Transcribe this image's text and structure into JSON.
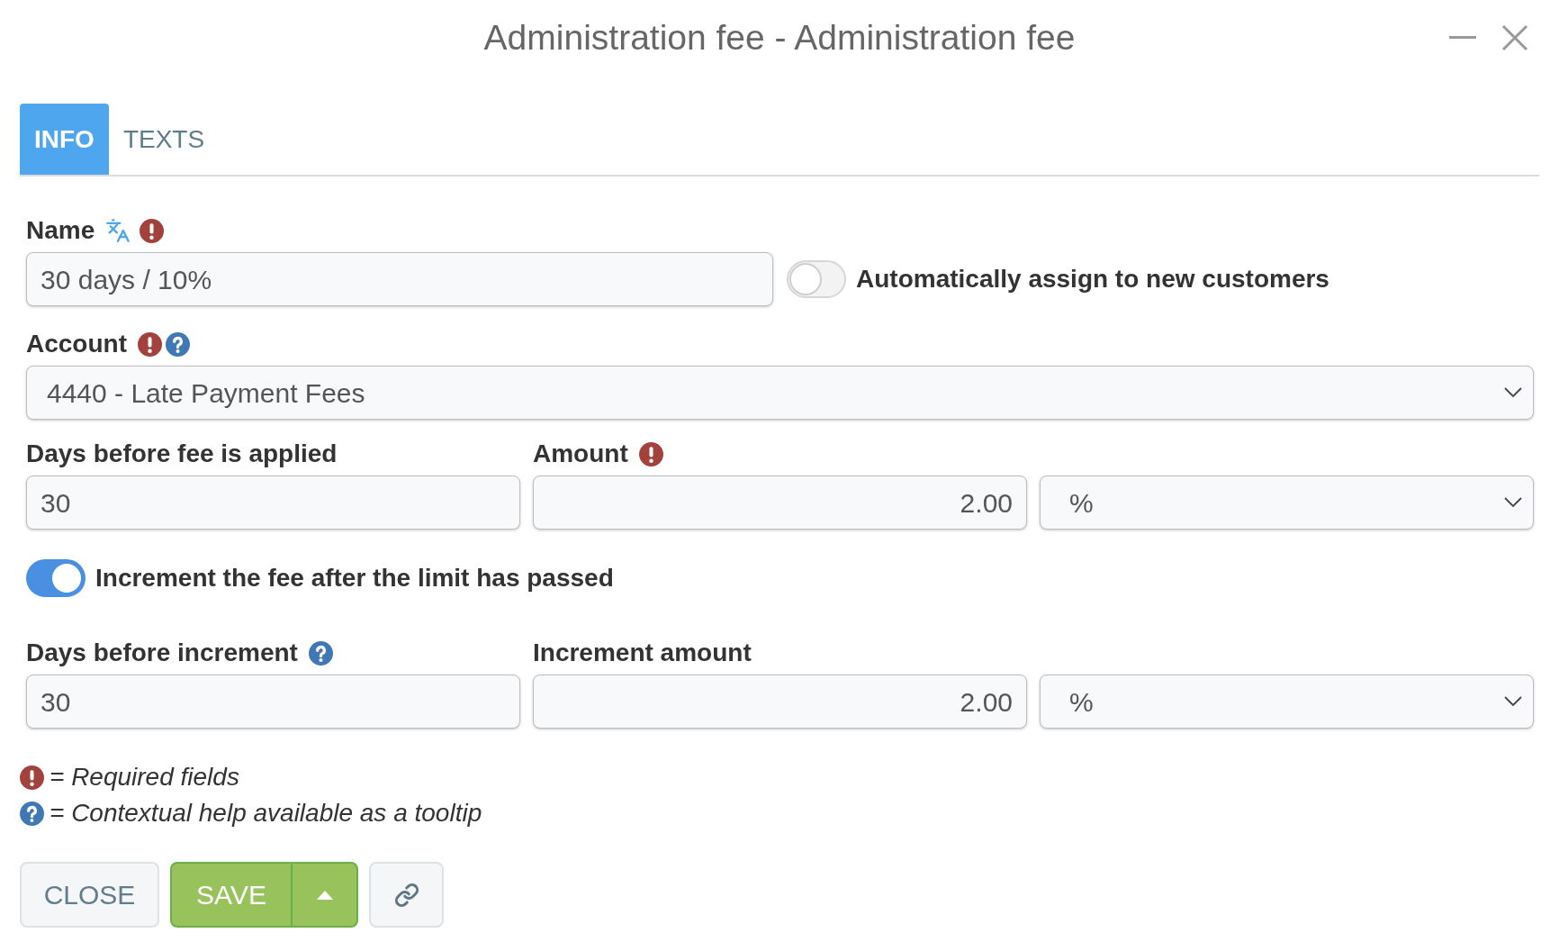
{
  "window": {
    "title": "Administration fee - Administration fee"
  },
  "tabs": [
    {
      "label": "INFO",
      "selected": true
    },
    {
      "label": "TEXTS",
      "selected": false
    }
  ],
  "name_field": {
    "label": "Name",
    "translatable": true,
    "required": true,
    "help": false,
    "value": "30 days / 10%"
  },
  "auto_assign_toggle": {
    "label": "Automatically assign to new customers",
    "on": false
  },
  "account_field": {
    "label": "Account",
    "required": true,
    "help": true,
    "value": "4440 - Late Payment Fees"
  },
  "fee_row": [
    {
      "kind": "text",
      "label": "Days before fee is applied",
      "required": false,
      "help": false,
      "value": "30"
    },
    {
      "kind": "number",
      "label": "Amount",
      "required": true,
      "help": false,
      "value": "2.00"
    },
    {
      "kind": "select",
      "value": "%"
    }
  ],
  "increment_toggle": {
    "label": "Increment the fee after the limit has passed",
    "on": true
  },
  "increment_row": [
    {
      "kind": "text",
      "label": "Days before increment",
      "required": false,
      "help": true,
      "value": "30"
    },
    {
      "kind": "number",
      "label": "Increment amount",
      "required": false,
      "help": false,
      "value": "2.00"
    },
    {
      "kind": "select",
      "value": "%"
    }
  ],
  "legend": [
    {
      "kind": "required",
      "text": "= Required fields"
    },
    {
      "kind": "help",
      "text": "= Contextual help available as a tooltip"
    }
  ],
  "buttons": [
    {
      "kind": "secondary",
      "label": "CLOSE"
    },
    {
      "kind": "split",
      "label": "SAVE"
    },
    {
      "kind": "icon"
    }
  ]
}
